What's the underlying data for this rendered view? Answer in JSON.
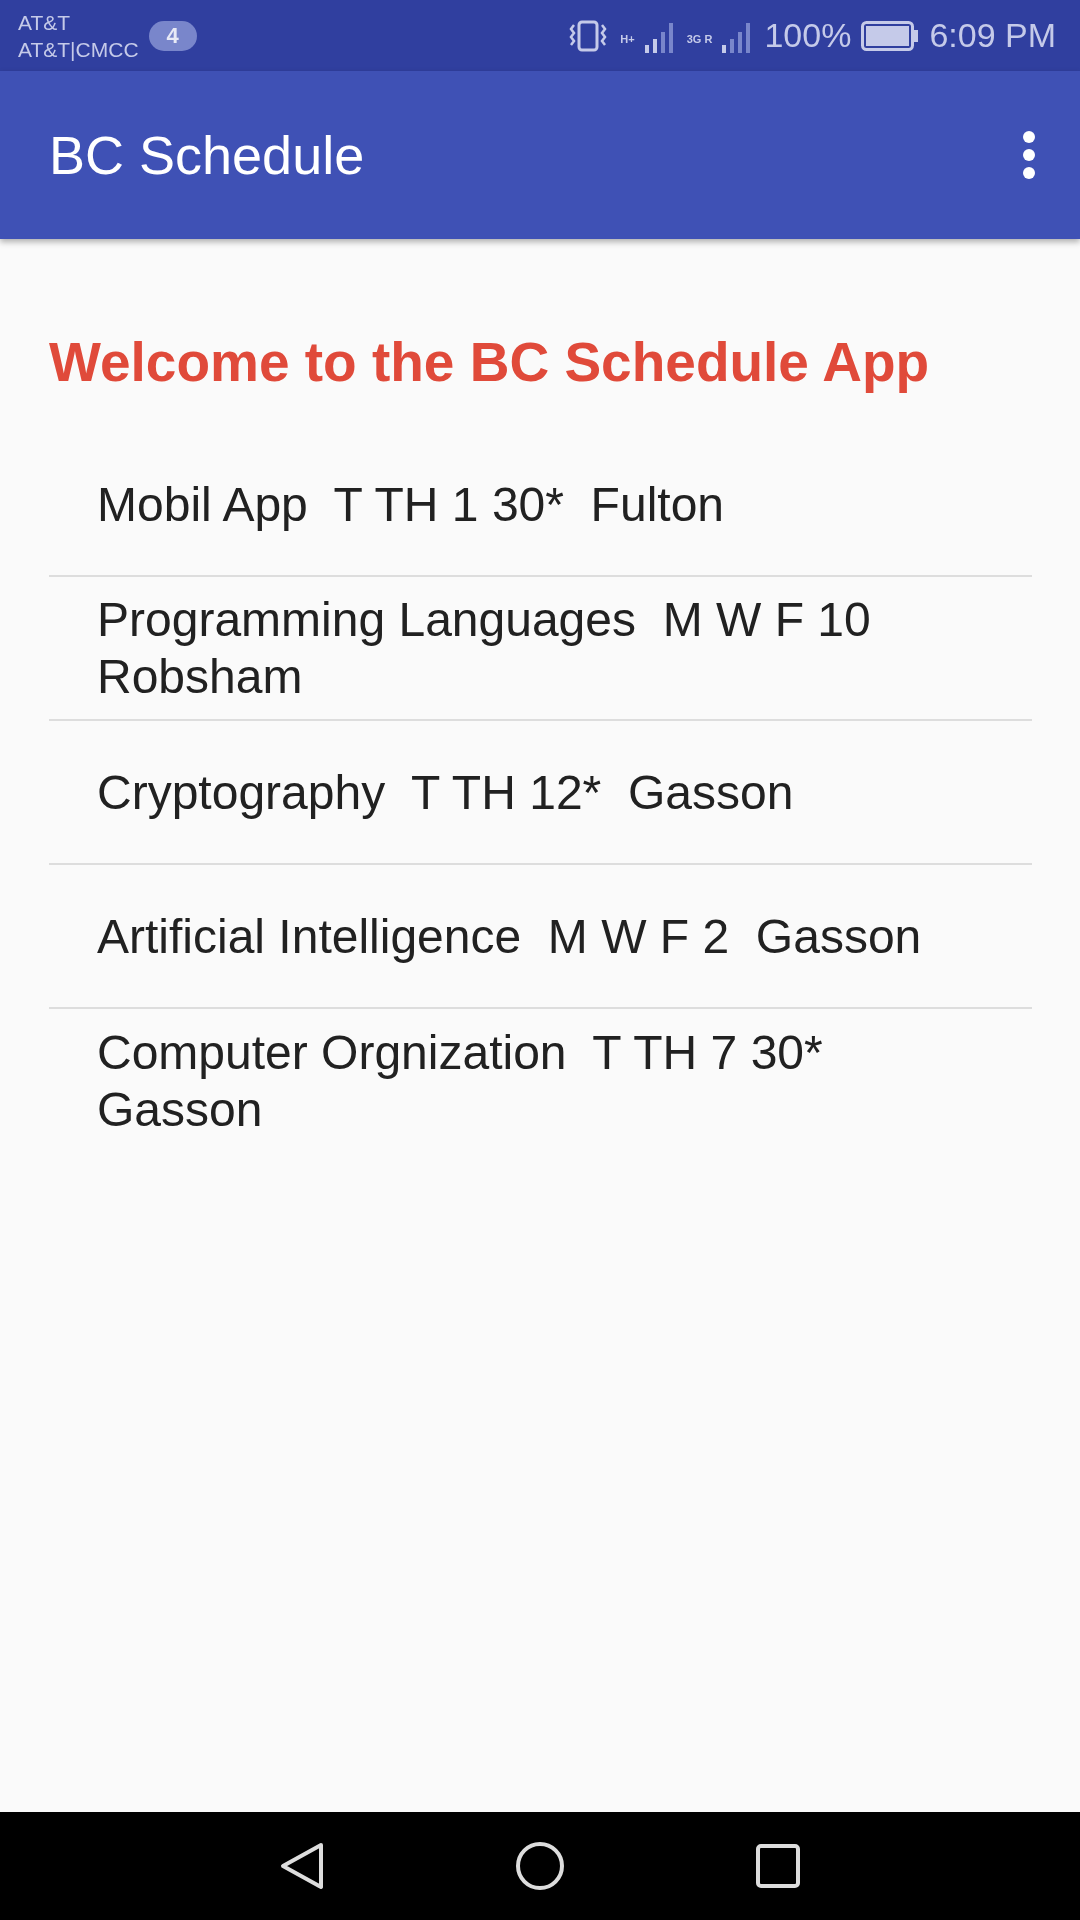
{
  "status_bar": {
    "carriers": [
      "AT&T",
      "AT&T|CMCC"
    ],
    "notification_count": "4",
    "network_1": "H+",
    "network_2": "3G R",
    "battery": "100%",
    "time": "6:09 PM"
  },
  "app_bar": {
    "title": "BC Schedule"
  },
  "welcome": "Welcome to the BC Schedule App",
  "courses": [
    {
      "text": "Mobil App  T TH 1 30*  Fulton"
    },
    {
      "text": "Programming Languages  M W F 10 Robsham"
    },
    {
      "text": "Cryptography  T TH 12*  Gasson"
    },
    {
      "text": "Artificial Intelligence  M W F 2  Gasson"
    },
    {
      "text": "Computer Orgnization  T TH 7 30* Gasson"
    }
  ]
}
